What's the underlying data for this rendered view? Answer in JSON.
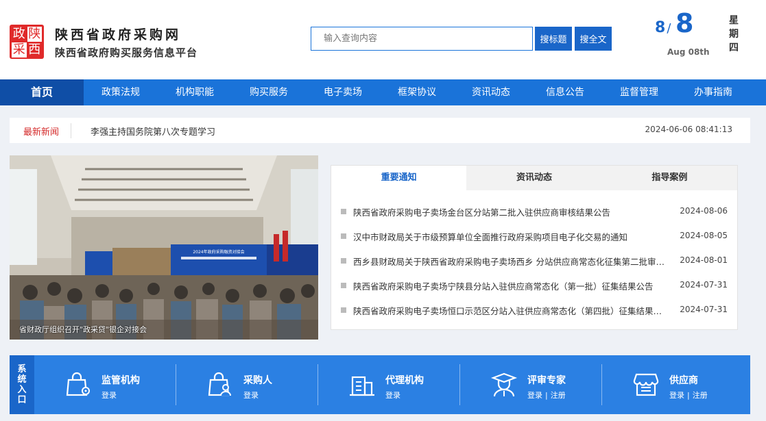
{
  "brand": {
    "logo_chars": [
      "政",
      "陕",
      "采",
      "西"
    ],
    "title": "陕西省政府采购网",
    "subtitle": "陕西省政府购买服务信息平台"
  },
  "search": {
    "placeholder": "输入查询内容",
    "btn_title": "搜标题",
    "btn_full": "搜全文"
  },
  "date": {
    "month": "8",
    "slash": "/",
    "day": "8",
    "en": "Aug 08th",
    "weekday": [
      "星",
      "期",
      "四"
    ]
  },
  "nav": [
    "首页",
    "政策法规",
    "机构职能",
    "购买服务",
    "电子卖场",
    "框架协议",
    "资讯动态",
    "信息公告",
    "监督管理",
    "办事指南"
  ],
  "latest": {
    "label": "最新新闻",
    "text": "李强主持国务院第八次专题学习",
    "time": "2024-06-06 08:41:13"
  },
  "photo": {
    "caption": "省财政厅组织召开\"政采贷\"银企对接会",
    "banner_text": "2024年政府采购融资对接会"
  },
  "tabs": [
    "重要通知",
    "资讯动态",
    "指导案例"
  ],
  "notices": [
    {
      "title": "陕西省政府采购电子卖场金台区分站第二批入驻供应商审核结果公告",
      "date": "2024-08-06"
    },
    {
      "title": "汉中市财政局关于市级预算单位全面推行政府采购项目电子化交易的通知",
      "date": "2024-08-05"
    },
    {
      "title": "西乡县财政局关于陕西省政府采购电子卖场西乡 分站供应商常态化征集第二批审核结果公告",
      "date": "2024-08-01"
    },
    {
      "title": "陕西省政府采购电子卖场宁陕县分站入驻供应商常态化（第一批）征集结果公告",
      "date": "2024-07-31"
    },
    {
      "title": "陕西省政府采购电子卖场恒口示范区分站入驻供应商常态化（第四批）征集结果公告",
      "date": "2024-07-31"
    }
  ],
  "entry": {
    "label": [
      "系",
      "统",
      "入",
      "口"
    ],
    "items": [
      {
        "name": "监管机构",
        "icon": "bag-lock-icon",
        "links": [
          "登录"
        ]
      },
      {
        "name": "采购人",
        "icon": "bag-user-icon",
        "links": [
          "登录"
        ]
      },
      {
        "name": "代理机构",
        "icon": "building-icon",
        "links": [
          "登录"
        ]
      },
      {
        "name": "评审专家",
        "icon": "expert-icon",
        "links": [
          "登录",
          "注册"
        ]
      },
      {
        "name": "供应商",
        "icon": "store-icon",
        "links": [
          "登录",
          "注册"
        ]
      }
    ],
    "link_sep": "|"
  },
  "colors": {
    "primary": "#1a73d9",
    "nav_active": "#0f4ea6",
    "entry_bg": "#2b80e3",
    "accent_red": "#d42a2a"
  }
}
